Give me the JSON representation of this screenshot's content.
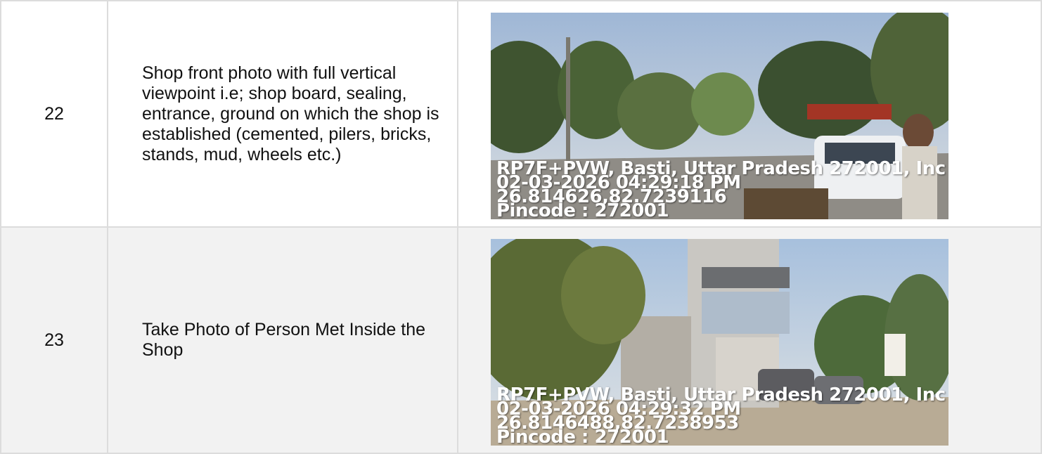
{
  "rows": [
    {
      "number": "22",
      "description": "Shop front photo with full vertical viewpoint i.e; shop board, sealing, entrance, ground on which the shop is established (cemented, pilers, bricks, stands, mud, wheels etc.)",
      "photo": {
        "address": "RP7F+PVW, Basti, Uttar Pradesh 272001, Inc",
        "datetime": "02-03-2026 04:29:18 PM",
        "coordinates": "26.814626,82.7239116",
        "pincode": "Pincode : 272001"
      }
    },
    {
      "number": "23",
      "description": "Take Photo of Person Met Inside the Shop",
      "photo": {
        "address": "RP7F+PVW, Basti, Uttar Pradesh 272001, Inc",
        "datetime": "02-03-2026 04:29:32 PM",
        "coordinates": "26.8146488,82.7238953",
        "pincode": "Pincode : 272001"
      }
    }
  ]
}
